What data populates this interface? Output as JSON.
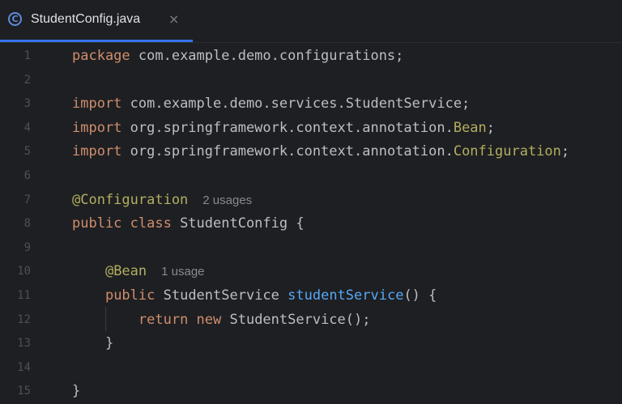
{
  "tab": {
    "icon": "class-icon",
    "icon_glyph": "C",
    "label": "StudentConfig.java",
    "close": "×"
  },
  "lines": [
    {
      "n": "1",
      "tokens": [
        [
          "kw",
          "package"
        ],
        [
          "plain",
          " com.example.demo.configurations;"
        ]
      ]
    },
    {
      "n": "2",
      "tokens": []
    },
    {
      "n": "3",
      "tokens": [
        [
          "kw",
          "import"
        ],
        [
          "plain",
          " com.example.demo.services.StudentService;"
        ]
      ]
    },
    {
      "n": "4",
      "tokens": [
        [
          "kw",
          "import"
        ],
        [
          "plain",
          " org.springframework.context.annotation."
        ],
        [
          "ann",
          "Bean"
        ],
        [
          "plain",
          ";"
        ]
      ]
    },
    {
      "n": "5",
      "tokens": [
        [
          "kw",
          "import"
        ],
        [
          "plain",
          " org.springframework.context.annotation."
        ],
        [
          "ann",
          "Configuration"
        ],
        [
          "plain",
          ";"
        ]
      ]
    },
    {
      "n": "6",
      "tokens": []
    },
    {
      "n": "7",
      "tokens": [
        [
          "ann",
          "@Configuration"
        ]
      ],
      "hint": "2 usages"
    },
    {
      "n": "8",
      "tokens": [
        [
          "kw",
          "public class"
        ],
        [
          "plain",
          " StudentConfig {"
        ]
      ]
    },
    {
      "n": "9",
      "tokens": []
    },
    {
      "n": "10",
      "tokens": [
        [
          "plain",
          "    "
        ],
        [
          "ann",
          "@Bean"
        ]
      ],
      "hint": "1 usage"
    },
    {
      "n": "11",
      "tokens": [
        [
          "plain",
          "    "
        ],
        [
          "kw",
          "public"
        ],
        [
          "plain",
          " StudentService "
        ],
        [
          "fn",
          "studentService"
        ],
        [
          "plain",
          "() {"
        ]
      ]
    },
    {
      "n": "12",
      "tokens": [
        [
          "plain",
          "        "
        ],
        [
          "kw",
          "return new"
        ],
        [
          "plain",
          " StudentService();"
        ]
      ]
    },
    {
      "n": "13",
      "tokens": [
        [
          "plain",
          "    }"
        ]
      ]
    },
    {
      "n": "14",
      "tokens": []
    },
    {
      "n": "15",
      "tokens": [
        [
          "plain",
          "}"
        ]
      ]
    }
  ],
  "colors": {
    "background": "#1e1f22",
    "keyword": "#cf8e6d",
    "annotation": "#b3ae60",
    "function": "#56a8f5",
    "text": "#bcbec4",
    "hint": "#868a91",
    "line_number": "#4b5059",
    "tab_underline": "#3574f0"
  }
}
